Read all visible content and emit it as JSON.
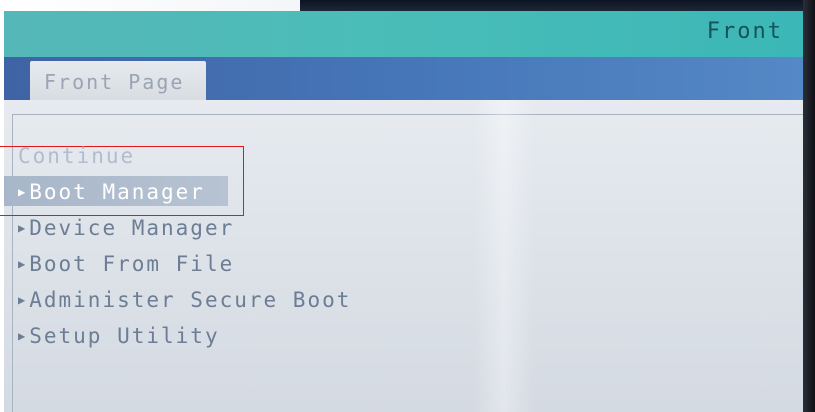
{
  "title_bar": {
    "title": "Front"
  },
  "tabs": [
    {
      "label": "Front Page",
      "active": true
    }
  ],
  "menu": {
    "items": [
      {
        "label": "Continue",
        "has_arrow": false
      },
      {
        "label": "Boot Manager",
        "has_arrow": true,
        "selected": true
      },
      {
        "label": "Device Manager",
        "has_arrow": true
      },
      {
        "label": "Boot From File",
        "has_arrow": true
      },
      {
        "label": "Administer Secure Boot",
        "has_arrow": true
      },
      {
        "label": "Setup Utility",
        "has_arrow": true
      }
    ],
    "arrow_glyph": "▶"
  },
  "colors": {
    "title_bar": "#4bbdb8",
    "tab_row": "#4676b8",
    "content_bg": "#dfe4ea",
    "menu_text": "#6d7d94",
    "selected_text": "#ffffff",
    "annotation": "#e01818"
  }
}
